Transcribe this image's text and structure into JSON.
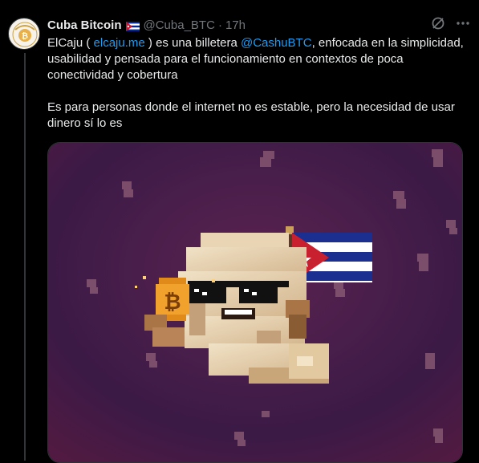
{
  "tweet": {
    "author_name": "Cuba Bitcoin",
    "author_handle": "@Cuba_BTC",
    "separator": "·",
    "time": "17h",
    "text": {
      "p1_a": "ElCaju ( ",
      "link_url": "elcaju.me",
      "p1_b": " ) es una billetera ",
      "mention": "@CashuBTC",
      "p1_c": ", enfocada en la simplicidad, usabilidad y pensada para el funcionamiento en contextos de poca conectividad y cobertura",
      "p2": "Es para personas donde el internet no es estable, pero la necesidad de usar dinero sí lo es"
    },
    "icons": {
      "flag": "cuba-flag-emoji",
      "grok": "grok-icon",
      "more": "more-icon"
    },
    "colors": {
      "link": "#1d9bf0",
      "muted": "#71767b",
      "media_bg_top": "#3a1a4c",
      "media_bg_bottom": "#6a1f4a"
    }
  }
}
